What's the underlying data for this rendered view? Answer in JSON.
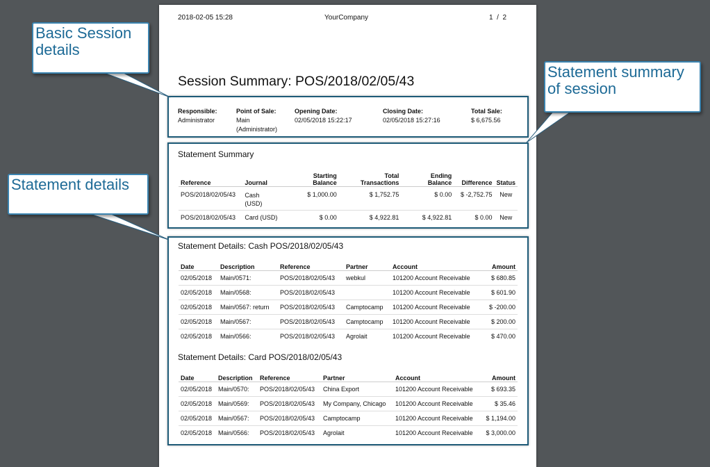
{
  "header": {
    "datetime": "2018-02-05 15:28",
    "company": "YourCompany",
    "page_num": "1",
    "page_sep": "/",
    "page_total": "2"
  },
  "title": "Session Summary: POS/2018/02/05/43",
  "session": {
    "responsible_label": "Responsible:",
    "responsible": "Administrator",
    "pos_label": "Point of Sale:",
    "pos_line1": "Main",
    "pos_line2": "(Administrator)",
    "opening_label": "Opening Date:",
    "opening": "02/05/2018 15:22:17",
    "closing_label": "Closing Date:",
    "closing": "02/05/2018 15:27:16",
    "total_label": "Total Sale:",
    "total": "$ 6,675.56"
  },
  "summary": {
    "heading": "Statement Summary",
    "cols": {
      "reference": "Reference",
      "journal": "Journal",
      "starting1": "Starting",
      "starting2": "Balance",
      "total1": "Total",
      "total2": "Transactions",
      "ending1": "Ending",
      "ending2": "Balance",
      "difference": "Difference",
      "status": "Status"
    },
    "rows": [
      {
        "reference": "POS/2018/02/05/43",
        "journal1": "Cash",
        "journal2": "(USD)",
        "starting": "$ 1,000.00",
        "transactions": "$ 1,752.75",
        "ending": "$ 0.00",
        "difference": "$ -2,752.75",
        "status": "New"
      },
      {
        "reference": "POS/2018/02/05/43",
        "journal1": "Card (USD)",
        "journal2": "",
        "starting": "$ 0.00",
        "transactions": "$ 4,922.81",
        "ending": "$ 4,922.81",
        "difference": "$ 0.00",
        "status": "New"
      }
    ]
  },
  "cash": {
    "heading": "Statement Details: Cash POS/2018/02/05/43",
    "cols": {
      "date": "Date",
      "description": "Description",
      "reference": "Reference",
      "partner": "Partner",
      "account": "Account",
      "amount": "Amount"
    },
    "rows": [
      {
        "date": "02/05/2018",
        "description": "Main/0571:",
        "reference": "POS/2018/02/05/43",
        "partner": "webkul",
        "account": "101200 Account Receivable",
        "amount": "$ 680.85"
      },
      {
        "date": "02/05/2018",
        "description": "Main/0568:",
        "reference": "POS/2018/02/05/43",
        "partner": "",
        "account": "101200 Account Receivable",
        "amount": "$ 601.90"
      },
      {
        "date": "02/05/2018",
        "description": "Main/0567: return",
        "reference": "POS/2018/02/05/43",
        "partner": "Camptocamp",
        "account": "101200 Account Receivable",
        "amount": "$ -200.00"
      },
      {
        "date": "02/05/2018",
        "description": "Main/0567:",
        "reference": "POS/2018/02/05/43",
        "partner": "Camptocamp",
        "account": "101200 Account Receivable",
        "amount": "$ 200.00"
      },
      {
        "date": "02/05/2018",
        "description": "Main/0566:",
        "reference": "POS/2018/02/05/43",
        "partner": "Agrolait",
        "account": "101200 Account Receivable",
        "amount": "$ 470.00"
      }
    ]
  },
  "card": {
    "heading": "Statement Details: Card POS/2018/02/05/43",
    "cols": {
      "date": "Date",
      "description": "Description",
      "reference": "Reference",
      "partner": "Partner",
      "account": "Account",
      "amount": "Amount"
    },
    "rows": [
      {
        "date": "02/05/2018",
        "description": "Main/0570:",
        "reference": "POS/2018/02/05/43",
        "partner": "China Export",
        "account": "101200 Account Receivable",
        "amount": "$ 693.35"
      },
      {
        "date": "02/05/2018",
        "description": "Main/0569:",
        "reference": "POS/2018/02/05/43",
        "partner": "My Company, Chicago",
        "account": "101200 Account Receivable",
        "amount": "$ 35.46"
      },
      {
        "date": "02/05/2018",
        "description": "Main/0567:",
        "reference": "POS/2018/02/05/43",
        "partner": "Camptocamp",
        "account": "101200 Account Receivable",
        "amount": "$ 1,194.00"
      },
      {
        "date": "02/05/2018",
        "description": "Main/0566:",
        "reference": "POS/2018/02/05/43",
        "partner": "Agrolait",
        "account": "101200 Account Receivable",
        "amount": "$ 3,000.00"
      }
    ]
  },
  "callouts": {
    "basic": "Basic Session details",
    "summary": "Statement summary of session",
    "details": "Statement details"
  },
  "colors": {
    "callout_border": "#3b84b0",
    "callout_text": "#1d6a96",
    "box_border": "#1e5b78",
    "background": "#525659"
  }
}
